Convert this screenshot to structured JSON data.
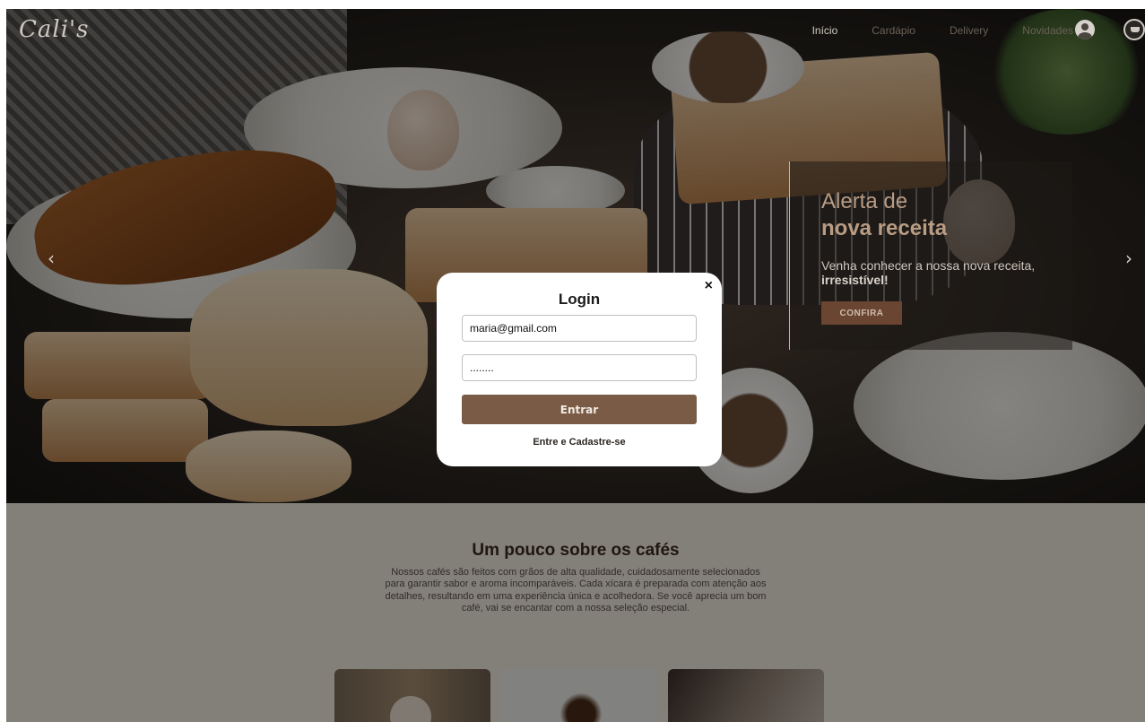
{
  "brand": {
    "logo": "Cali's"
  },
  "nav": {
    "items": [
      "Início",
      "Cardápio",
      "Delivery",
      "Novidades"
    ]
  },
  "hero": {
    "prev_arrow": "‹",
    "next_arrow": "›",
    "promo": {
      "title_line1": "Alerta de",
      "title_line2": "nova receita",
      "text": "Venha conhecer a nossa nova receita,",
      "text_bold": "irresistível!",
      "button": "CONFIRA"
    }
  },
  "about": {
    "title": "Um pouco sobre os cafés",
    "text": "Nossos cafés são feitos com grãos de alta qualidade, cuidadosamente selecionados para garantir sabor e aroma incomparáveis. Cada xícara é preparada com atenção aos detalhes, resultando em uma experiência única e acolhedora. Se você aprecia um bom café, vai se encantar com a nossa seleção especial."
  },
  "login_modal": {
    "close": "×",
    "title": "Login",
    "email_value": "maria@gmail.com",
    "password_value": "........",
    "submit": "Entrar",
    "signup_link": "Entre e Cadastre-se"
  },
  "colors": {
    "accent": "#7a5c46",
    "promo_button": "#6a4532",
    "heading": "#3a2b1d"
  },
  "icons": [
    "user-icon",
    "cart-icon",
    "close-icon",
    "chevron-left-icon",
    "chevron-right-icon"
  ]
}
